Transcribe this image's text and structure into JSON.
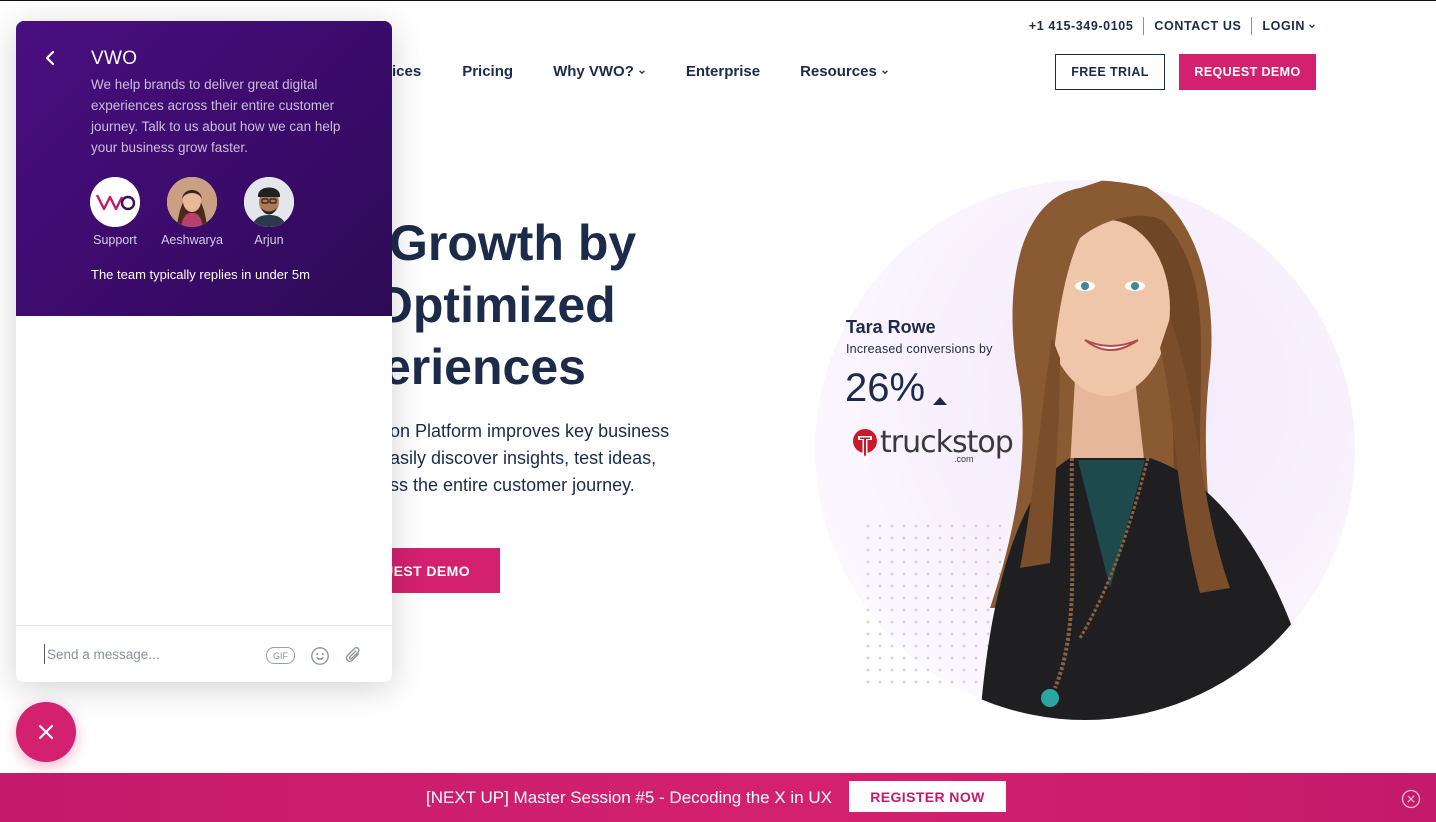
{
  "header": {
    "phone": "+1 415-349-0105",
    "contact": "CONTACT US",
    "login": "LOGIN",
    "nav": [
      "ices",
      "Pricing",
      "Why VWO?",
      "Enterprise",
      "Resources"
    ],
    "free_trial": "FREE TRIAL",
    "request_demo": "REQUEST DEMO"
  },
  "hero": {
    "title_lines": [
      "Growth by",
      "Optimized",
      "eriences"
    ],
    "subtitle_lines": [
      "on Platform improves key business",
      "asily discover insights, test ideas,",
      "ss the entire customer journey."
    ],
    "cta": "UEST DEMO"
  },
  "testimonial": {
    "name": "Tara Rowe",
    "line": "Increased conversions by",
    "percent": "26%",
    "brand": "truckstop",
    "brand_suffix": ".com"
  },
  "chat": {
    "title": "VWO",
    "description": "We help brands to deliver great digital experiences across their entire customer journey. Talk to us about how we can help your business grow faster.",
    "agents": [
      {
        "name": "Support",
        "logo": "VWO"
      },
      {
        "name": "Aeshwarya"
      },
      {
        "name": "Arjun"
      }
    ],
    "reply_note": "The team typically replies in under 5m",
    "input_placeholder": "Send a message...",
    "gif_label": "GIF"
  },
  "banner": {
    "message": "[NEXT UP] Master Session #5 - Decoding the X in UX",
    "register": "REGISTER NOW"
  },
  "colors": {
    "brand_pink": "#d4216f",
    "navy": "#1c2b4a",
    "chat_purple": "#3b0b6b"
  }
}
